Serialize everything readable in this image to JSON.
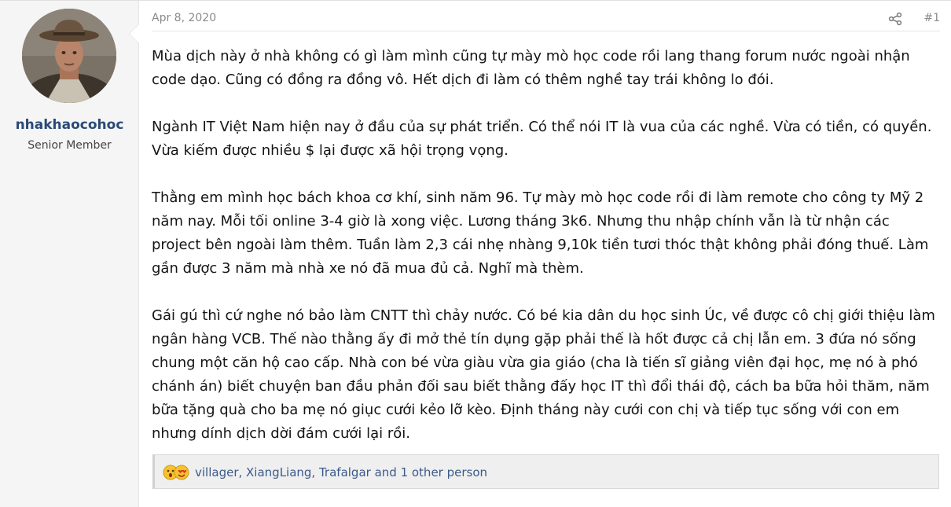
{
  "user": {
    "name": "nhakhaocohoc",
    "title": "Senior Member"
  },
  "post": {
    "date": "Apr 8, 2020",
    "number": "#1",
    "paragraphs": [
      "Mùa dịch này ở nhà không có gì làm mình cũng tự mày mò học code rồi lang thang forum nước ngoài nhận code dạo. Cũng có đồng ra đồng vô. Hết dịch đi làm có thêm nghề tay trái không lo đói.",
      "Ngành IT Việt Nam hiện nay ở đầu của sự phát triển. Có thể nói IT là vua của các nghề. Vừa có tiền, có quyền. Vừa kiếm được nhiều $ lại được xã hội trọng vọng.",
      "Thằng em mình học bách khoa cơ khí, sinh năm 96. Tự mày mò học code rồi đi làm remote cho công ty Mỹ 2 năm nay. Mỗi tối online 3-4 giờ là xong việc. Lương tháng 3k6. Nhưng thu nhập chính vẫn là từ nhận các project bên ngoài làm thêm. Tuần làm 2,3 cái nhẹ nhàng 9,10k tiền tươi thóc thật không phải đóng thuế. Làm gần được 3 năm mà nhà xe nó đã mua đủ cả. Nghĩ mà thèm.",
      "Gái gú thì cứ nghe nó bảo làm CNTT thì chảy nước. Có bé kia dân du học sinh Úc, về được cô chị giới thiệu làm ngân hàng VCB. Thế nào thằng ấy đi mở thẻ tín dụng gặp phải thế là hốt được cả chị lẫn em. 3 đứa nó sống chung một căn hộ cao cấp. Nhà con bé vừa giàu vừa gia giáo (cha là tiến sĩ giảng viên đại học, mẹ nó à phó chánh án) biết chuyện ban đầu phản đối sau biết thằng đấy học IT thì đổi thái độ, cách ba bữa hỏi thăm, năm bữa tặng quà cho ba mẹ nó giục cưới kẻo lỡ kèo. Định tháng này cưới con chị và tiếp tục sống với con em nhưng dính dịch dời đám cưới lại rồi."
    ]
  },
  "reactions": {
    "text": "villager, XiangLiang, Trafalgar and 1 other person",
    "icons": [
      "wow-emoji-icon",
      "love-emoji-icon"
    ]
  },
  "colors": {
    "username": "#2a4a76",
    "link": "#3b5a8a",
    "sidebar_bg": "#f5f5f5",
    "reaction_bar_bg": "#efefef"
  }
}
